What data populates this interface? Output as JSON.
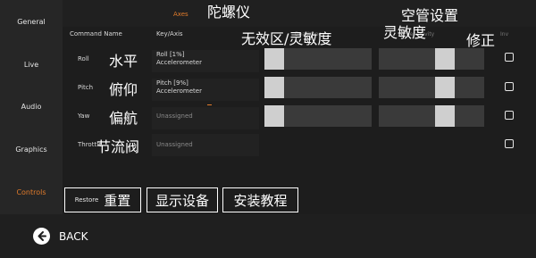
{
  "sidebar": {
    "items": [
      {
        "label": "General"
      },
      {
        "label": "Live"
      },
      {
        "label": "Audio"
      },
      {
        "label": "Graphics"
      },
      {
        "label": "Controls"
      }
    ]
  },
  "tabs": {
    "axes_label": "Axes"
  },
  "table": {
    "headers": {
      "command": "Command Name",
      "keyaxis": "Key/Axis",
      "deadzone": "Deadzone",
      "sensitivity": "Sensitivity",
      "invert": "Inv"
    },
    "rows": [
      {
        "name": "Roll",
        "key_line1": "Roll [1%]",
        "key_line2": "Accelerometer",
        "annotation": "水平"
      },
      {
        "name": "Pitch",
        "key_line1": "Pitch [9%]",
        "key_line2": "Accelerometer",
        "annotation": "俯仰"
      },
      {
        "name": "Yaw",
        "key_line1": "Unassigned",
        "key_line2": "",
        "annotation": "偏航"
      },
      {
        "name": "Throttle",
        "key_line1": "Unassigned",
        "key_line2": "",
        "annotation": "节流阀"
      }
    ]
  },
  "annotations": {
    "gyroscope": "陀螺仪",
    "deadzone_sensitivity": "无效区/灵敏度",
    "hollow_settings": "空管设置",
    "sensitivity": "灵敏度",
    "correct": "修正"
  },
  "buttons": {
    "restore_label": "Restore",
    "reset_label": "重置",
    "show_devices_label": "显示设备",
    "install_tutorial_label": "安装教程"
  },
  "footer": {
    "back_label": "BACK"
  },
  "colors": {
    "accent": "#e07b2b",
    "background": "#1f1f1f",
    "slider_track": "#3a3a3a",
    "slider_thumb": "#cfcfcf"
  }
}
